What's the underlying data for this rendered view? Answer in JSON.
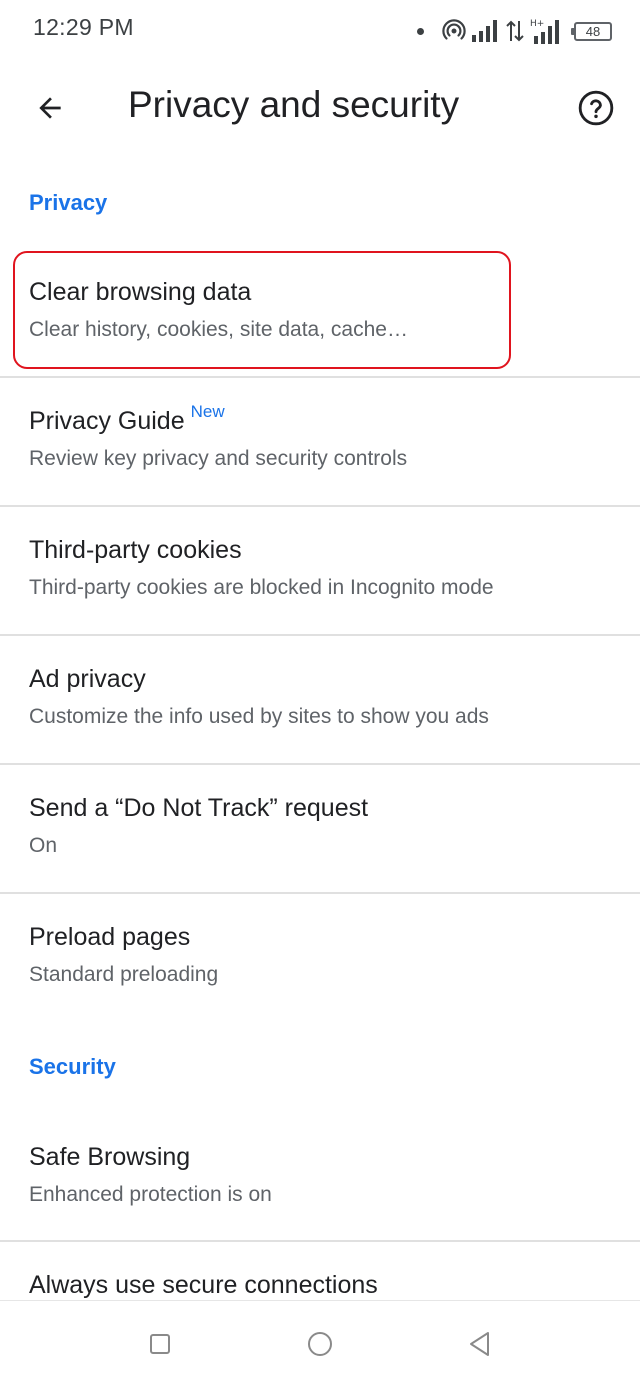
{
  "status_bar": {
    "time": "12:29 PM",
    "battery": "48",
    "icons": [
      "notification-dot-icon",
      "hotspot-icon",
      "signal-icon",
      "data-transfer-icon",
      "hplus-signal-icon",
      "battery-icon"
    ]
  },
  "app_bar": {
    "title": "Privacy and security",
    "back_icon": "arrow-back-icon",
    "help_icon": "help-icon"
  },
  "sections": {
    "privacy": "Privacy",
    "security": "Security"
  },
  "privacy_items": [
    {
      "title": "Clear browsing data",
      "subtitle": "Clear history, cookies, site data, cache…"
    },
    {
      "title": "Privacy Guide",
      "badge": "New",
      "subtitle": "Review key privacy and security controls"
    },
    {
      "title": "Third-party cookies",
      "subtitle": "Third-party cookies are blocked in Incognito mode"
    },
    {
      "title": "Ad privacy",
      "subtitle": "Customize the info used by sites to show you ads"
    },
    {
      "title": "Send a “Do Not Track” request",
      "subtitle": "On"
    },
    {
      "title": "Preload pages",
      "subtitle": "Standard preloading"
    }
  ],
  "security_items": [
    {
      "title": "Safe Browsing",
      "subtitle": "Enhanced protection is on"
    },
    {
      "title": "Always use secure connections",
      "subtitle": ""
    }
  ],
  "colors": {
    "accent": "#1a73e8",
    "highlight": "#e0141e",
    "divider": "#e0e0e0",
    "primary_text": "#202124",
    "secondary_text": "#5f6368"
  },
  "nav_bar": {
    "icons": [
      "recents-square-icon",
      "home-circle-icon",
      "back-triangle-icon"
    ]
  }
}
